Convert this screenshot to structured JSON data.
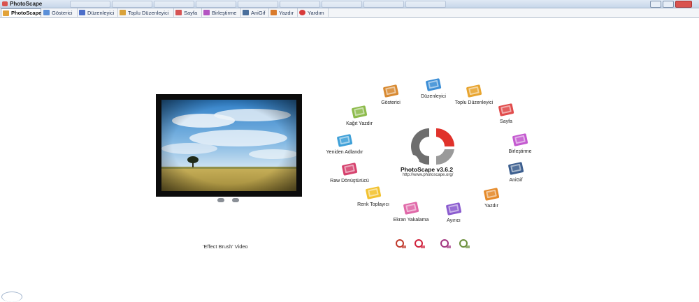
{
  "window": {
    "title": "PhotoScape"
  },
  "tabs": [
    {
      "label": "PhotoScape",
      "icon": "photoscape-icon",
      "color": "#e2a33a"
    },
    {
      "label": "Gösterici",
      "icon": "viewer-icon",
      "color": "#5a8fd8"
    },
    {
      "label": "Düzenleyici",
      "icon": "editor-icon",
      "color": "#4d6fc9"
    },
    {
      "label": "Toplu Düzenleyici",
      "icon": "batch-editor-icon",
      "color": "#d9a23b"
    },
    {
      "label": "Sayfa",
      "icon": "page-icon",
      "color": "#d65454"
    },
    {
      "label": "Birleştirme",
      "icon": "combine-icon",
      "color": "#b455c2"
    },
    {
      "label": "AniGif",
      "icon": "anigif-icon",
      "color": "#4a6f9c"
    },
    {
      "label": "Yazdır",
      "icon": "print-icon",
      "color": "#d97a2b"
    },
    {
      "label": "Yardım",
      "icon": "help-icon",
      "color": "#d83a3a"
    }
  ],
  "home": {
    "video_label": "'Effect Brush' Video",
    "brand": "PhotoScape v3.6.2",
    "url": "http://www.photoscape.org/",
    "modules": [
      {
        "label": "Düzenleyici",
        "icon": "editor-icon",
        "color": "#3c8ed6"
      },
      {
        "label": "Toplu Düzenleyici",
        "icon": "batch-editor-icon",
        "color": "#e8a530"
      },
      {
        "label": "Sayfa",
        "icon": "page-icon",
        "color": "#e14b4b"
      },
      {
        "label": "Birleştirme",
        "icon": "combine-icon",
        "color": "#c45ad0"
      },
      {
        "label": "AniGif",
        "icon": "anigif-icon",
        "color": "#3d5f8f"
      },
      {
        "label": "Yazdır",
        "icon": "print-icon",
        "color": "#e58a2a"
      },
      {
        "label": "Ayırıcı",
        "icon": "splitter-icon",
        "color": "#8b5ccf"
      },
      {
        "label": "Ekran Yakalama",
        "icon": "screen-capture-icon",
        "color": "#e068a8"
      },
      {
        "label": "Renk Toplayıcı",
        "icon": "color-picker-icon",
        "color": "#f2c230"
      },
      {
        "label": "Raw Dönüştürücü",
        "icon": "raw-converter-icon",
        "color": "#d6426e"
      },
      {
        "label": "Yeniden Adlandır",
        "icon": "rename-icon",
        "color": "#3fa0d8"
      },
      {
        "label": "Kağıt Yazdır",
        "icon": "paper-print-icon",
        "color": "#8dbb4c"
      },
      {
        "label": "Gösterici",
        "icon": "viewer-icon",
        "color": "#d88a32"
      }
    ],
    "tools": [
      {
        "icon": "magnifier-tool-icon",
        "color": "#c0392b"
      },
      {
        "icon": "text-glyph-tool-icon",
        "color": "#d0203a"
      },
      {
        "icon": "headphones-tool-icon",
        "color": "#a2337f"
      },
      {
        "icon": "picture-frame-tool-icon",
        "color": "#6a8f3a"
      }
    ]
  }
}
